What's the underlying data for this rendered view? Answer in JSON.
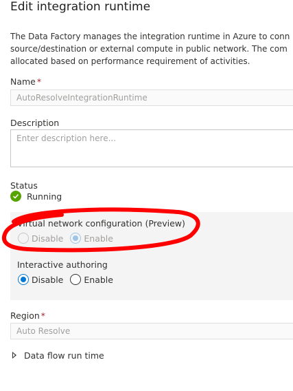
{
  "header": {
    "title": "Edit integration runtime"
  },
  "description_lines": [
    "The Data Factory manages the integration runtime in Azure to conn",
    "source/destination or external compute in public network. The com",
    "allocated based on performance requirement of activities."
  ],
  "name": {
    "label": "Name",
    "required_mark": "*",
    "value": "AutoResolveIntegrationRuntime"
  },
  "description": {
    "label": "Description",
    "placeholder": "Enter description here..."
  },
  "status": {
    "label": "Status",
    "value": "Running",
    "color": "#57a300"
  },
  "vnet": {
    "label": "Virtual network configuration (Preview)",
    "options": [
      {
        "label": "Disable",
        "selected": false,
        "disabled": true
      },
      {
        "label": "Enable",
        "selected": true,
        "disabled": true
      }
    ]
  },
  "interactive": {
    "label": "Interactive authoring",
    "options": [
      {
        "label": "Disable",
        "selected": true,
        "disabled": false
      },
      {
        "label": "Enable",
        "selected": false,
        "disabled": false
      }
    ]
  },
  "region": {
    "label": "Region",
    "required_mark": "*",
    "value": "Auto Resolve"
  },
  "dataflow": {
    "label": "Data flow run time",
    "icon": "caret-right-icon"
  },
  "annotation": {
    "color": "#ff0000",
    "shape": "hand-drawn-oval"
  },
  "colors": {
    "accent": "#0078d4",
    "required": "#a4262c",
    "panel": "#f4f4f4"
  }
}
